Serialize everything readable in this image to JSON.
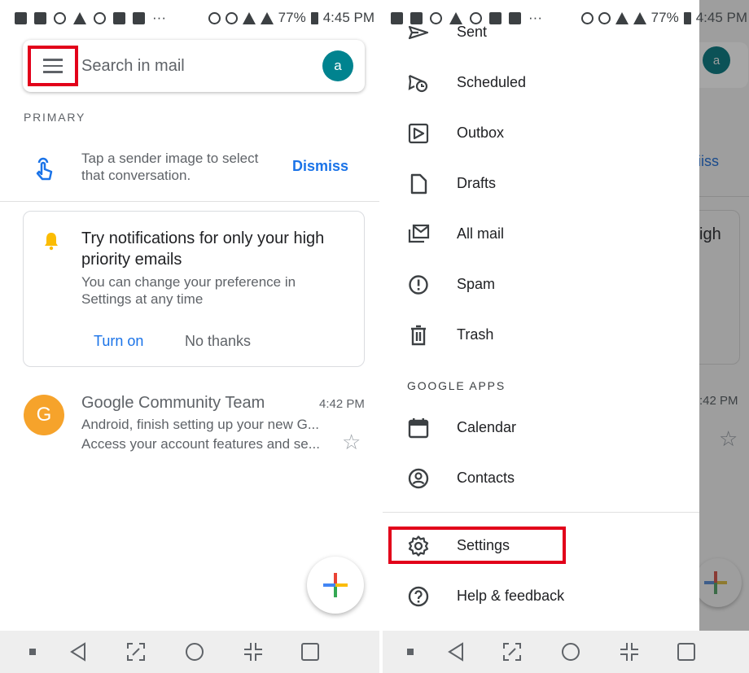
{
  "status_bar": {
    "battery": "77%",
    "time": "4:45 PM",
    "more": "···"
  },
  "search": {
    "placeholder": "Search in mail",
    "avatar_letter": "a"
  },
  "section_label": "PRIMARY",
  "tip": {
    "text": "Tap a sender image to select that conversation.",
    "dismiss": "Dismiss"
  },
  "notif_card": {
    "title": "Try notifications for only your high priority emails",
    "subtitle": "You can change your preference in Settings at any time",
    "turn_on": "Turn on",
    "no_thanks": "No thanks"
  },
  "email": {
    "avatar": "G",
    "sender": "Google Community Team",
    "time": "4:42 PM",
    "subject": "Android, finish setting up your new G...",
    "preview": "Access your account features and se..."
  },
  "drawer": {
    "items": [
      {
        "label": "Sent",
        "icon": "send-icon"
      },
      {
        "label": "Scheduled",
        "icon": "schedule-send-icon"
      },
      {
        "label": "Outbox",
        "icon": "outbox-icon"
      },
      {
        "label": "Drafts",
        "icon": "draft-icon"
      },
      {
        "label": "All mail",
        "icon": "all-mail-icon"
      },
      {
        "label": "Spam",
        "icon": "spam-icon"
      },
      {
        "label": "Trash",
        "icon": "trash-icon"
      }
    ],
    "apps_heading": "GOOGLE APPS",
    "apps": [
      {
        "label": "Calendar",
        "icon": "calendar-icon"
      },
      {
        "label": "Contacts",
        "icon": "contacts-icon"
      }
    ],
    "settings": "Settings",
    "help": "Help & feedback"
  },
  "peek": {
    "avatar_letter": "a",
    "dismiss_fragment": "iiss",
    "title_fragment": "igh",
    "time_fragment": ":42 PM"
  },
  "colors": {
    "accent": "#1a73e8",
    "highlight": "#e2001a",
    "avatar_teal": "#00838f",
    "avatar_orange": "#f6a32b",
    "bell": "#fbbc04"
  }
}
